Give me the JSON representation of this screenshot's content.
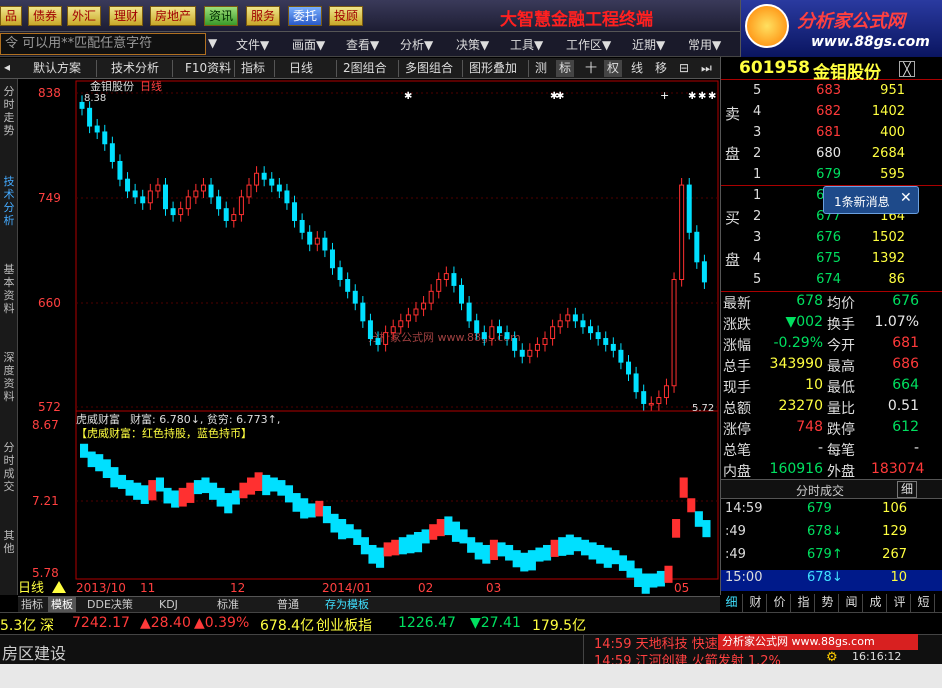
{
  "nav": {
    "items": [
      "品",
      "债券",
      "外汇",
      "理财",
      "房地产",
      "资讯",
      "服务",
      "委托",
      "投顾"
    ],
    "app_title": "大智慧金融工程终端",
    "brand_name": "分析家公式网",
    "brand_url": "www.88gs.com"
  },
  "menu": {
    "command_placeholder": "令  可以用**匹配任意字符",
    "items": [
      "文件▼",
      "画面▼",
      "查看▼",
      "分析▼",
      "决策▼",
      "工具▼",
      "工作区▼",
      "近期▼",
      "常用▼"
    ]
  },
  "toolbar": {
    "items": [
      "默认方案",
      "技术分析",
      "F10资料",
      "指标",
      "日线",
      "2图组合",
      "多图组合",
      "图形叠加",
      "测",
      "标",
      "十",
      "权",
      "线",
      "移",
      "⊟",
      "⏭"
    ]
  },
  "left_tabs": [
    "分时走势",
    "技术分析",
    "基本资料",
    "深度资料",
    "分时成交",
    "其他"
  ],
  "chart": {
    "stock_label": "金钼股份",
    "period_label": "日线",
    "high_marker": "8.38",
    "low_marker": "5.72",
    "price_axis": [
      "838",
      "749",
      "660",
      "572"
    ],
    "indicator_axis": [
      "8.67",
      "7.21",
      "5.78"
    ],
    "indicator_title": "虎威财富",
    "indicator_caption": "财富: 6.780↓, 贫穷: 6.773↑,",
    "indicator_legend": "【虎威财富：红色持股，蓝色持币】",
    "date_axis": [
      "2013/10",
      "11",
      "12",
      "2014/01",
      "02",
      "03",
      "05"
    ],
    "watermark": "分析家公式网 www.88gs.com",
    "period_badge": "日线",
    "colors": {
      "up": "#ff3030",
      "down": "#00e0ff",
      "axis": "#b00000",
      "grid": "#600000"
    }
  },
  "chart_data": {
    "type": "candlestick",
    "price_axis_range": [
      5.72,
      8.38
    ],
    "indicator_axis_range": [
      5.78,
      8.67
    ],
    "closes": [
      8.25,
      8.1,
      8.05,
      7.95,
      7.8,
      7.65,
      7.55,
      7.5,
      7.45,
      7.55,
      7.6,
      7.4,
      7.35,
      7.4,
      7.5,
      7.55,
      7.6,
      7.5,
      7.4,
      7.3,
      7.35,
      7.5,
      7.6,
      7.7,
      7.65,
      7.6,
      7.55,
      7.45,
      7.3,
      7.2,
      7.1,
      7.15,
      7.05,
      6.9,
      6.8,
      6.7,
      6.6,
      6.45,
      6.3,
      6.25,
      6.35,
      6.4,
      6.45,
      6.5,
      6.55,
      6.6,
      6.7,
      6.8,
      6.85,
      6.75,
      6.6,
      6.45,
      6.35,
      6.3,
      6.4,
      6.35,
      6.3,
      6.2,
      6.15,
      6.2,
      6.25,
      6.3,
      6.4,
      6.45,
      6.5,
      6.45,
      6.4,
      6.35,
      6.3,
      6.25,
      6.2,
      6.1,
      6.0,
      5.85,
      5.75,
      5.75,
      5.8,
      5.9,
      6.8,
      7.6,
      7.2,
      6.95,
      6.78
    ]
  },
  "quote": {
    "code": "601958",
    "name": "金钼股份",
    "close_glyph": "╳",
    "sell_label_top": "卖",
    "sell_label_bottom": "盘",
    "buy_label_top": "买",
    "buy_label_bottom": "盘",
    "sell": [
      {
        "lvl": "5",
        "px": "683",
        "vol": "951",
        "c": "red"
      },
      {
        "lvl": "4",
        "px": "682",
        "vol": "1402",
        "c": "red"
      },
      {
        "lvl": "3",
        "px": "681",
        "vol": "400",
        "c": "red"
      },
      {
        "lvl": "2",
        "px": "680",
        "vol": "2684",
        "c": "white"
      },
      {
        "lvl": "1",
        "px": "679",
        "vol": "595",
        "c": "green"
      }
    ],
    "buy": [
      {
        "lvl": "1",
        "px": "678",
        "vol": "",
        "c": "green"
      },
      {
        "lvl": "2",
        "px": "677",
        "vol": "164",
        "c": "green"
      },
      {
        "lvl": "3",
        "px": "676",
        "vol": "1502",
        "c": "green"
      },
      {
        "lvl": "4",
        "px": "675",
        "vol": "1392",
        "c": "green"
      },
      {
        "lvl": "5",
        "px": "674",
        "vol": "86",
        "c": "green"
      }
    ],
    "stats": [
      {
        "l": "最新",
        "lv": "678",
        "lc": "green",
        "r": "均价",
        "rv": "676",
        "rc": "green"
      },
      {
        "l": "涨跌",
        "lv": "▼002",
        "lc": "green",
        "r": "换手",
        "rv": "1.07%",
        "rc": "white"
      },
      {
        "l": "涨幅",
        "lv": "-0.29%",
        "lc": "green",
        "r": "今开",
        "rv": "681",
        "rc": "red"
      },
      {
        "l": "总手",
        "lv": "343990",
        "lc": "yellow",
        "r": "最高",
        "rv": "686",
        "rc": "red"
      },
      {
        "l": "现手",
        "lv": "10",
        "lc": "yellow",
        "r": "最低",
        "rv": "664",
        "rc": "green"
      },
      {
        "l": "总额",
        "lv": "23270",
        "lc": "yellow",
        "r": "量比",
        "rv": "0.51",
        "rc": "white"
      },
      {
        "l": "涨停",
        "lv": "748",
        "lc": "red",
        "r": "跌停",
        "rv": "612",
        "rc": "green"
      },
      {
        "l": "总笔",
        "lv": "-",
        "lc": "white",
        "r": "每笔",
        "rv": "-",
        "rc": "white"
      },
      {
        "l": "内盘",
        "lv": "160916",
        "lc": "green",
        "r": "外盘",
        "rv": "183074",
        "rc": "red"
      }
    ],
    "trade_title": "分时成交",
    "trade_btn": "细",
    "trades": [
      {
        "t": "14:59",
        "p": "679",
        "v": "106",
        "c": "green"
      },
      {
        "t": ":49",
        "p": "678↓",
        "v": "129",
        "c": "green"
      },
      {
        "t": ":49",
        "p": "679↑",
        "v": "267",
        "c": "green"
      },
      {
        "t": "15:00",
        "p": "678↓",
        "v": "10",
        "c": "cyan"
      }
    ],
    "bottom_tabs": [
      "细",
      "财",
      "价",
      "指",
      "势",
      "闻",
      "成",
      "评",
      "短"
    ]
  },
  "notice": {
    "text": "1条新消息",
    "close": "✕"
  },
  "bottom_tabs": [
    "指标",
    "模板",
    "DDE决策",
    "KDJ",
    "标准",
    "普通",
    "存为模板"
  ],
  "ticker": [
    {
      "text": "5.3亿",
      "c": "yellow"
    },
    {
      "text": "深",
      "c": "yellow"
    },
    {
      "text": "7242.17",
      "c": "red"
    },
    {
      "text": "▲28.40",
      "c": "red"
    },
    {
      "text": "▲0.39%",
      "c": "red"
    },
    {
      "text": "678.4亿",
      "c": "yellow"
    },
    {
      "text": "创业板指",
      "c": "yellow"
    },
    {
      "text": "1226.47",
      "c": "green"
    },
    {
      "text": "▼27.41",
      "c": "green"
    },
    {
      "text": "179.5亿",
      "c": "yellow"
    }
  ],
  "status": {
    "left_text": "房区建设",
    "news": [
      "14:59 天地科技 快速",
      "14:59 江河创建 火箭发射 1.2%"
    ],
    "clock": "16:16:12",
    "banner": "分析家公式网 www.88gs.com"
  }
}
